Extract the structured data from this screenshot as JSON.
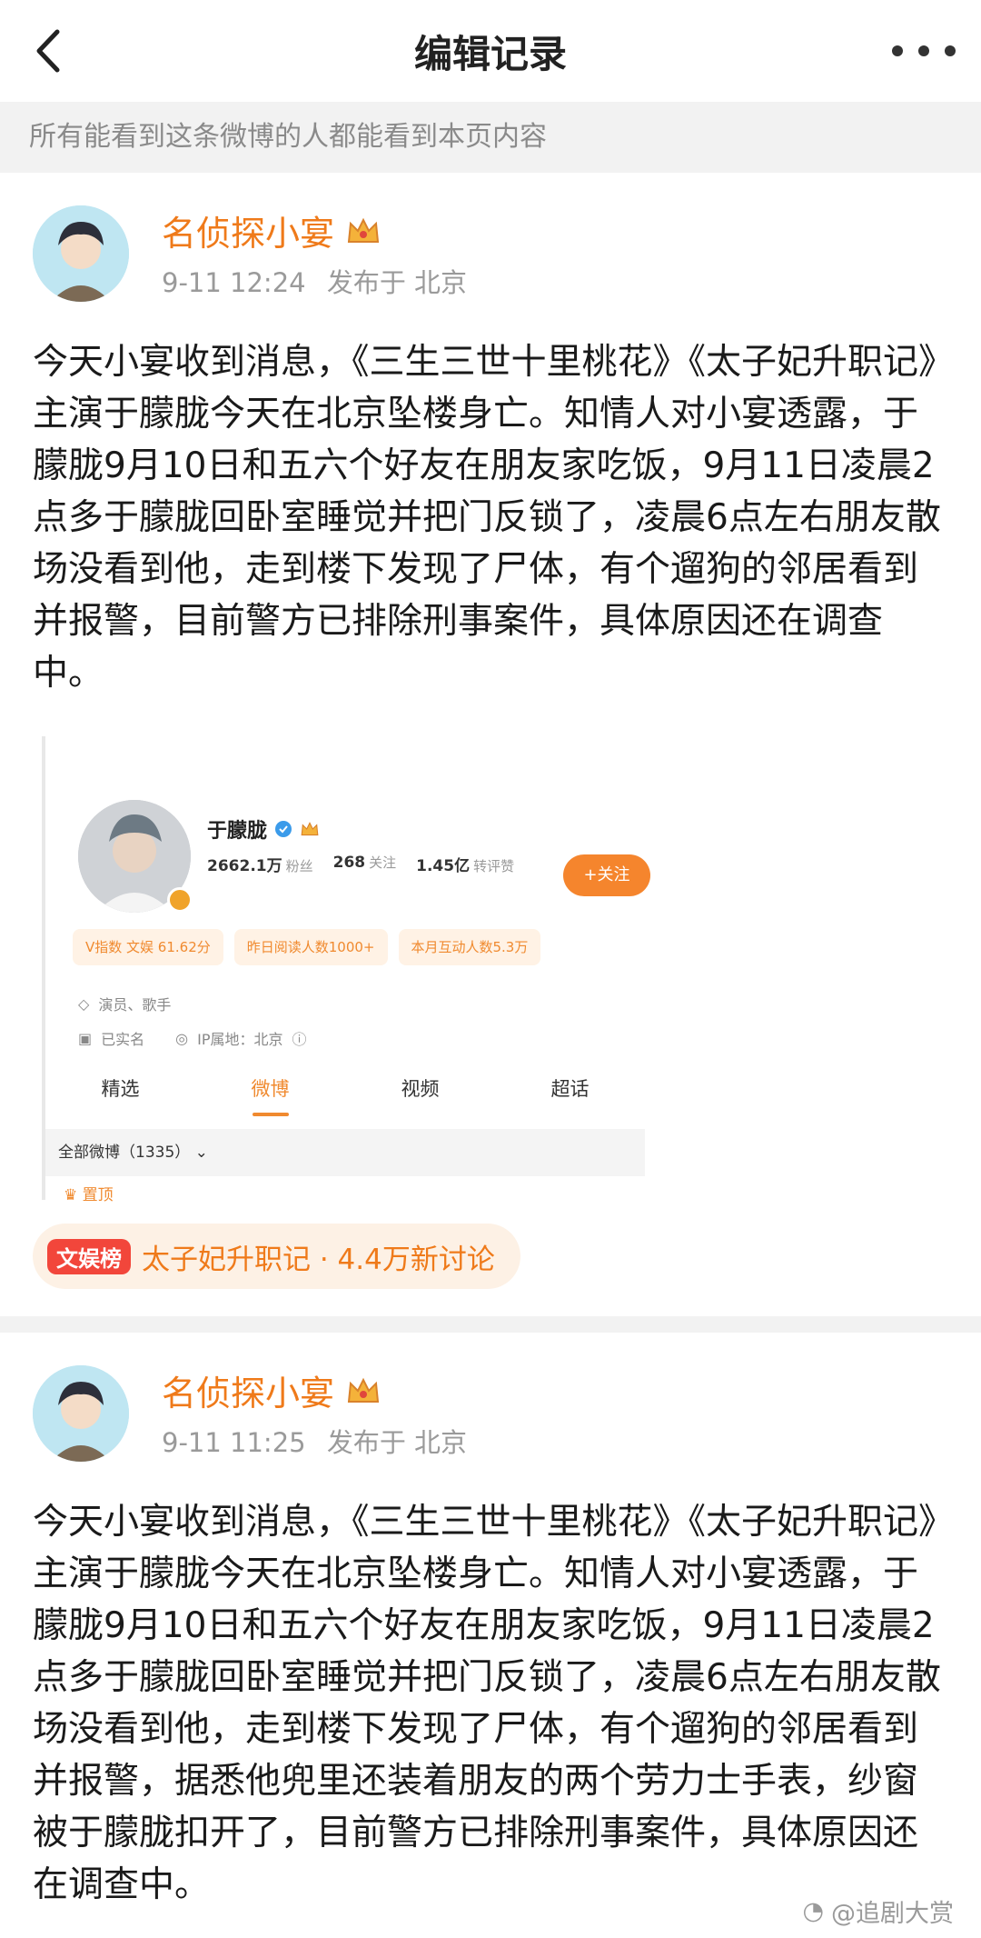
{
  "nav": {
    "title": "编辑记录"
  },
  "notice": "所有能看到这条微博的人都能看到本页内容",
  "posts": [
    {
      "author": "名侦探小宴",
      "time": "9-11 12:24",
      "location": "发布于 北京",
      "content": "今天小宴收到消息，《三生三世十里桃花》《太子妃升职记》主演于朦胧今天在北京坠楼身亡。知情人对小宴透露，于朦胧9月10日和五六个好友在朋友家吃饭，9月11日凌晨2点多于朦胧回卧室睡觉并把门反锁了，凌晨6点左右朋友散场没看到他，走到楼下发现了尸体，有个遛狗的邻居看到并报警，目前警方已排除刑事案件，具体原因还在调查中。"
    },
    {
      "author": "名侦探小宴",
      "time": "9-11 11:25",
      "location": "发布于 北京",
      "content": "今天小宴收到消息，《三生三世十里桃花》《太子妃升职记》主演于朦胧今天在北京坠楼身亡。知情人对小宴透露，于朦胧9月10日和五六个好友在朋友家吃饭，9月11日凌晨2点多于朦胧回卧室睡觉并把门反锁了，凌晨6点左右朋友散场没看到他，走到楼下发现了尸体，有个遛狗的邻居看到并报警，据悉他兜里还装着朋友的两个劳力士手表，纱窗被于朦胧扣开了，目前警方已排除刑事案件，具体原因还在调查中。"
    }
  ],
  "embed": {
    "name": "于朦胧",
    "fans_value": "2662.1万",
    "fans_label": "粉丝",
    "follow_value": "268",
    "follow_label": "关注",
    "likes_value": "1.45亿",
    "likes_label": "转评赞",
    "follow_button": "+关注",
    "chips": [
      "V指数 文娱 61.62分",
      "昨日阅读人数1000+",
      "本月互动人数5.3万"
    ],
    "profession": "演员、歌手",
    "verified": "已实名",
    "ip": "IP属地：北京",
    "tabs": [
      "精选",
      "微博",
      "视频",
      "超话"
    ],
    "filter": "全部微博（1335）",
    "pinned": "置顶"
  },
  "topic": {
    "badge": "文娱榜",
    "text": "太子妃升职记 · 4.4万新讨论"
  },
  "watermark": "@追剧大赏",
  "colors": {
    "accent": "#ef7a1a",
    "follow": "#f5852d",
    "badge": "#f2463b"
  }
}
